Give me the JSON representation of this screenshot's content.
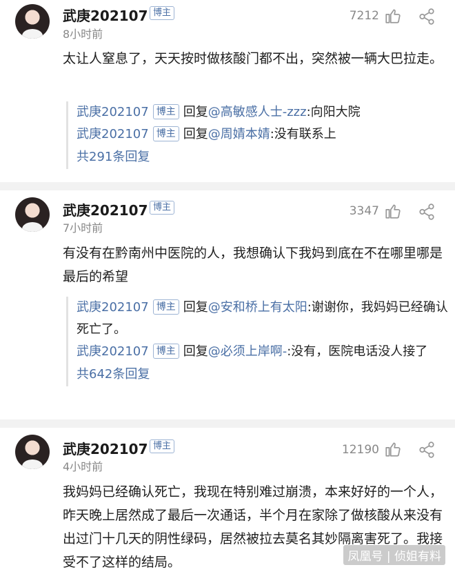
{
  "posts": [
    {
      "username": "武庚202107",
      "badge": "博主",
      "time": "8小时前",
      "likes": "7212",
      "text": "太让人窒息了，天天按时做核酸门都不出，突然被一辆大巴拉走。",
      "replies": [
        {
          "name": "武庚202107",
          "badge": "博主",
          "prefix": "回复",
          "mention": "@高敏感人士-zzz",
          "text": ":向阳大院"
        },
        {
          "name": "武庚202107",
          "badge": "博主",
          "prefix": "回复",
          "mention": "@周婧本婧",
          "text": ":没有联系上"
        }
      ],
      "more": "共291条回复"
    },
    {
      "username": "武庚202107",
      "badge": "博主",
      "time": "7小时前",
      "likes": "3347",
      "text": "有没有在黔南州中医院的人，我想确认下我妈到底在不在哪里哪是最后的希望",
      "replies": [
        {
          "name": "武庚202107",
          "badge": "博主",
          "prefix": "回复",
          "mention": "@安和桥上有太阳",
          "text": ":谢谢你，我妈妈已经确认死亡了。"
        },
        {
          "name": "武庚202107",
          "badge": "博主",
          "prefix": "回复",
          "mention": "@必须上岸啊-",
          "text": ":没有，医院电话没人接了"
        }
      ],
      "more": "共642条回复"
    },
    {
      "username": "武庚202107",
      "badge": "博主",
      "time": "4小时前",
      "likes": "12190",
      "text": "我妈妈已经确认死亡，我现在特别难过崩溃，本来好好的一个人，昨天晚上居然成了最后一次通话，半个月在家除了做核酸从来没有出过门十几天的阴性绿码，居然被拉去莫名其妙隔离害死了。我接受不了这样的结局。"
    }
  ],
  "watermark": "凤凰号 | 侦姐有料",
  "colors": {
    "link": "#4a6fa5",
    "muted": "#888888",
    "separator": "#f2f2f2"
  }
}
